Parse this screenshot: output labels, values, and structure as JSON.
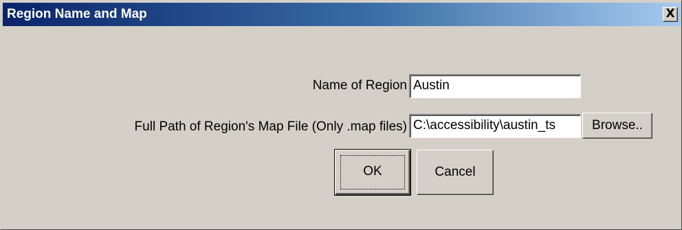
{
  "window": {
    "title": "Region Name and Map",
    "close_label": "X"
  },
  "form": {
    "region_name_label": "Name of Region",
    "region_name_value": "Austin",
    "map_path_label": "Full Path of Region's Map File (Only .map files)",
    "map_path_value": "C:\\accessibility\\austin_ts",
    "browse_label": "Browse.."
  },
  "buttons": {
    "ok_label": "OK",
    "cancel_label": "Cancel"
  },
  "colors": {
    "face": "#d4d0c8",
    "title_start": "#0a246a",
    "title_end": "#a6caf0"
  },
  "icons": {
    "close": "close-icon"
  }
}
